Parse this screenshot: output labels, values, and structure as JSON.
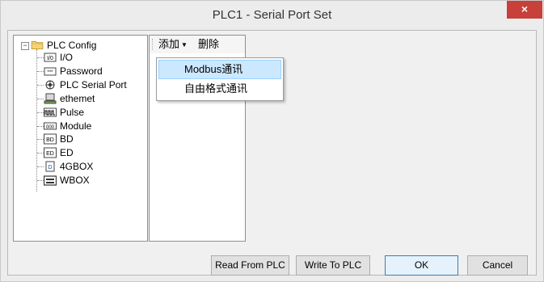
{
  "window": {
    "title": "PLC1 - Serial Port  Set",
    "close_glyph": "×"
  },
  "tree": {
    "root": {
      "label": "PLC Config",
      "expander": "−",
      "icon": "folder-icon"
    },
    "children": [
      {
        "label": "I/O",
        "icon": "io-icon",
        "icon_text": "I/0"
      },
      {
        "label": "Password",
        "icon": "password-icon",
        "icon_text": "***"
      },
      {
        "label": "PLC Serial Port",
        "icon": "serial-port-icon",
        "icon_text": ""
      },
      {
        "label": "ethemet",
        "icon": "ethernet-icon",
        "icon_text": ""
      },
      {
        "label": "Pulse",
        "icon": "pulse-icon",
        "icon_text": ""
      },
      {
        "label": "Module",
        "icon": "module-icon",
        "icon_text": "000"
      },
      {
        "label": "BD",
        "icon": "bd-icon",
        "icon_text": "BD"
      },
      {
        "label": "ED",
        "icon": "ed-icon",
        "icon_text": "ED"
      },
      {
        "label": "4GBOX",
        "icon": "4gbox-icon",
        "icon_text": "D"
      },
      {
        "label": "WBOX",
        "icon": "wbox-icon",
        "icon_text": ""
      }
    ]
  },
  "toolbar": {
    "add_label": "添加",
    "add_arrow": "▼",
    "delete_label": "删除"
  },
  "dropdown": {
    "items": [
      {
        "label": "Modbus通讯",
        "highlighted": true
      },
      {
        "label": "自由格式通讯",
        "highlighted": false
      }
    ]
  },
  "buttons": {
    "read_from_plc": "Read From PLC",
    "write_to_plc": "Write To PLC",
    "ok": "OK",
    "cancel": "Cancel"
  },
  "colors": {
    "close": "#c7403a",
    "highlight": "#cce8ff",
    "highlight_border": "#99d1ff",
    "default_button_border": "#3c7fb1"
  }
}
